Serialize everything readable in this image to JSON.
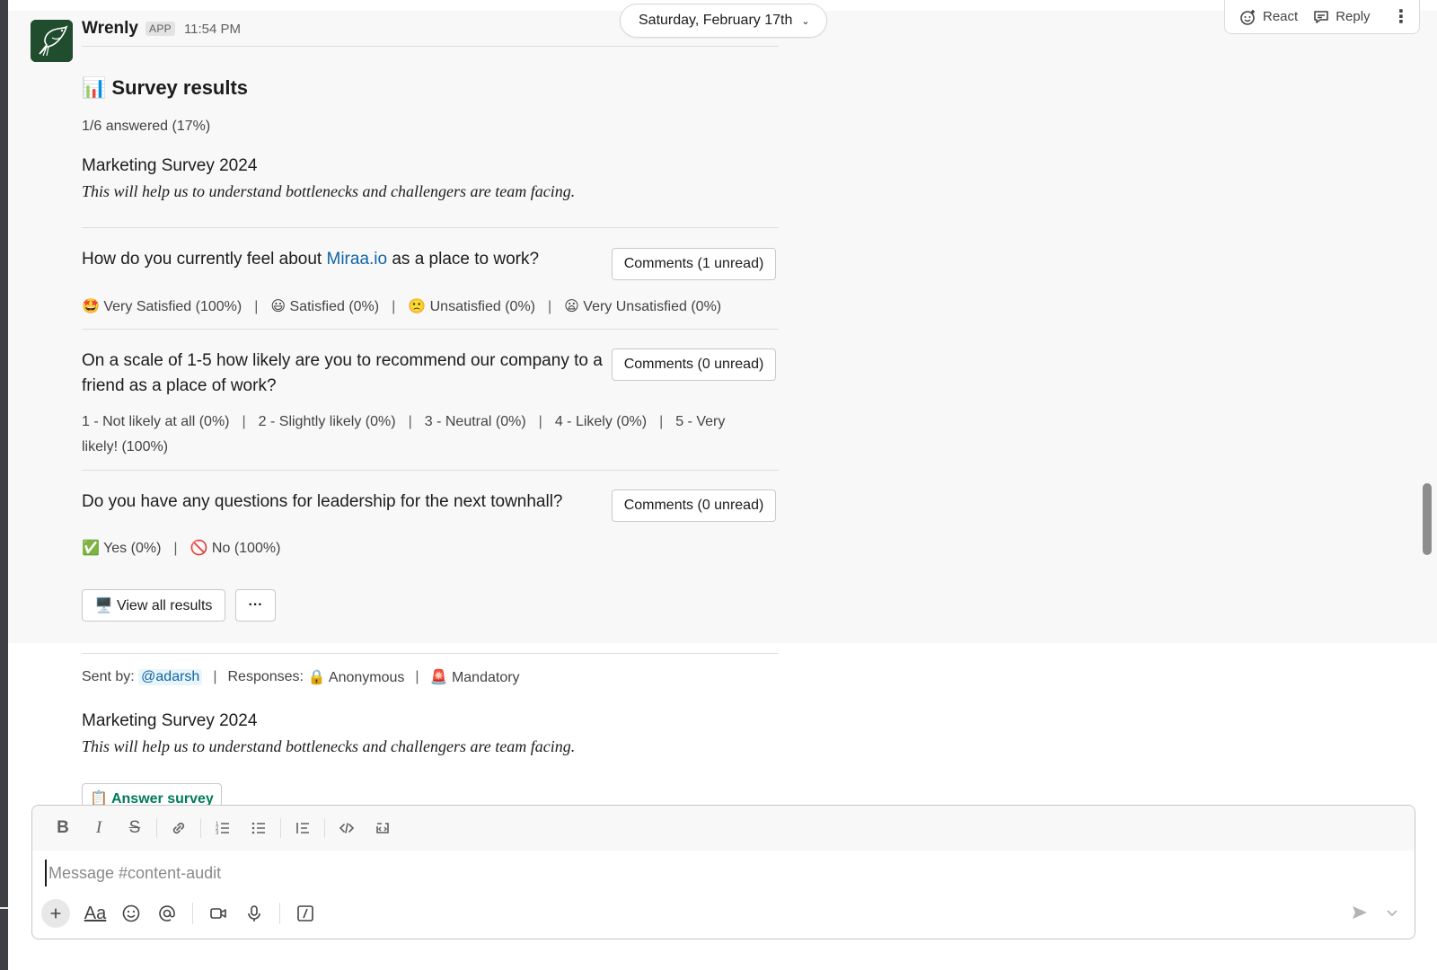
{
  "message": {
    "sender": "Wrenly",
    "badge": "APP",
    "time": "11:54 PM"
  },
  "date_divider": "Saturday, February 17th",
  "actions": {
    "react": "React",
    "reply": "Reply"
  },
  "results": {
    "title_emoji": "📊",
    "title": "Survey results",
    "answered": "1/6 answered (17%)",
    "survey_name": "Marketing Survey 2024",
    "survey_desc": "This will help us to understand bottlenecks and challengers are team facing.",
    "questions": [
      {
        "text_before": "How do you currently feel about ",
        "link": "Miraa.io",
        "text_after": " as a place to work?",
        "comments": "Comments (1 unread)",
        "options": [
          "🤩 Very Satisfied (100%)",
          "😃 Satisfied (0%)",
          "🙁 Unsatisfied (0%)",
          "😦 Very Unsatisfied (0%)"
        ]
      },
      {
        "text": "On a scale of 1-5 how likely are you to recommend our company to a friend as a place of work?",
        "comments": "Comments (0 unread)",
        "options_line1": [
          "1 - Not likely at all (0%)",
          "2 - Slightly likely (0%)",
          "3 - Neutral (0%)",
          "4 - Likely (0%)",
          "5 - Very"
        ],
        "options_line2": "likely! (100%)"
      },
      {
        "text": "Do you have any questions for leadership for the next townhall?",
        "comments": "Comments (0 unread)",
        "options": [
          "✅ Yes (0%)",
          "🚫 No (100%)"
        ]
      }
    ],
    "view_all": "🖥️ View all results",
    "more": "···"
  },
  "second_message": {
    "sent_by_label": "Sent by:",
    "mention": "@adarsh",
    "responses_label": "Responses:",
    "anonymous": "🔒 Anonymous",
    "mandatory": "🚨 Mandatory",
    "survey_name": "Marketing Survey 2024",
    "survey_desc": "This will help us to understand bottlenecks and challengers are team facing.",
    "answer_button": "📋 Answer survey"
  },
  "composer": {
    "placeholder": "Message #content-audit",
    "aa": "Aa"
  }
}
